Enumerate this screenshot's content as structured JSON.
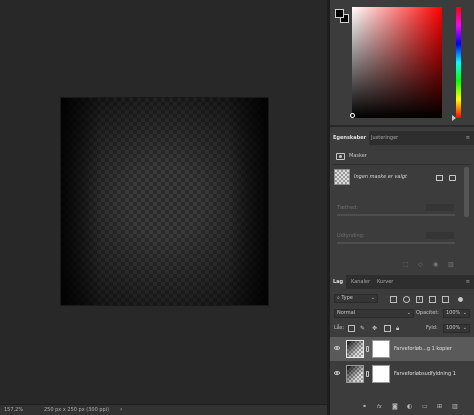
{
  "status_bar": {
    "zoom": "157,2%",
    "doc_info": "250 px x 250 px (300 ppi)",
    "arrow": "›"
  },
  "color_panel": {
    "foreground": "#000000",
    "background": "#000000"
  },
  "properties": {
    "tabs": [
      "Egenskaber",
      "Justeringer"
    ],
    "menu_icon": "≡",
    "mask_section_label": "Masker",
    "mask_status": "Ingen maske er valgt",
    "density_label": "Tæthed:",
    "feather_label": "Udtynding:"
  },
  "layers": {
    "tabs": [
      "Lag",
      "Kanaler",
      "Kurver"
    ],
    "menu_icon": "≡",
    "filter_kind": "Type",
    "blend_mode": "Normal",
    "opacity_label": "Opacitet:",
    "opacity_value": "100%",
    "lock_label": "Lås:",
    "fill_label": "Fyld:",
    "fill_value": "100%",
    "rows": [
      {
        "name": "Farveforløb...g 1 kopier",
        "selected": true
      },
      {
        "name": "Farveforløbsudfyldning 1",
        "selected": false
      }
    ],
    "footer_icons": [
      "link-icon",
      "fx-icon",
      "mask-icon",
      "adjustment-icon",
      "folder-icon",
      "new-layer-icon",
      "trash-icon"
    ]
  }
}
